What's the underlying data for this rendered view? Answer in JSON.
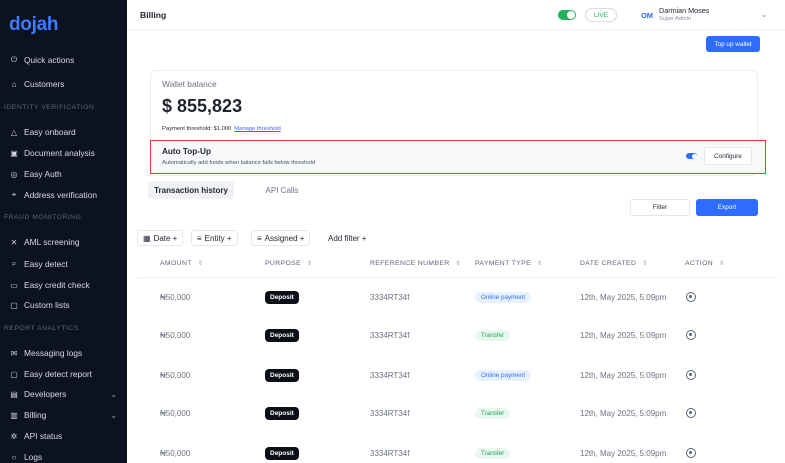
{
  "sidebar": {
    "logo": "dojah",
    "items": [
      {
        "label": "Quick actions",
        "icon": "⏻"
      },
      {
        "label": "Customers",
        "icon": "⌂"
      },
      {
        "label": "Easy onboard",
        "icon": "△"
      },
      {
        "label": "Document analysis",
        "icon": "▣"
      },
      {
        "label": "Easy Auth",
        "icon": "◎"
      },
      {
        "label": "Address verification",
        "icon": "⌖"
      },
      {
        "label": "AML screening",
        "icon": "✕"
      },
      {
        "label": "Easy detect",
        "icon": "⌕"
      },
      {
        "label": "Easy credit check",
        "icon": "▭"
      },
      {
        "label": "Custom lists",
        "icon": "▢"
      },
      {
        "label": "Messaging logs",
        "icon": "✉"
      },
      {
        "label": "Easy detect report",
        "icon": "▢"
      },
      {
        "label": "Developers",
        "icon": "▤"
      },
      {
        "label": "Billing",
        "icon": "▥"
      },
      {
        "label": "API status",
        "icon": "✲"
      },
      {
        "label": "Logs",
        "icon": "○"
      }
    ],
    "sections": {
      "identity": "IDENTITY VERIFICATION",
      "fraud": "FRAUD MONITORING",
      "report": "REPORT ANALYTICS"
    }
  },
  "header": {
    "title": "Billing",
    "mode": "LIVE",
    "avatar_initials": "OM",
    "user_name": "Darmian Moses",
    "user_role": "Super Admin",
    "top_up_label": "Top up wallet"
  },
  "wallet": {
    "label": "Wallet balance",
    "amount": "$ 855,823",
    "threshold_text": "Payment threshold: $1,000",
    "manage_link": "Manage threshold"
  },
  "auto_topup": {
    "title": "Auto Top-Up",
    "description": "Automatically add funds when balance falls below threshold",
    "configure_label": "Configure"
  },
  "tabs": [
    {
      "label": "Transaction history"
    },
    {
      "label": "API Calls"
    }
  ],
  "actions": {
    "filter_label": "Filter",
    "export_label": "Export"
  },
  "filters": [
    {
      "label": "Date +"
    },
    {
      "label": "Entity +"
    },
    {
      "label": "Assigned +"
    },
    {
      "label": "Add filter +"
    }
  ],
  "table": {
    "columns": [
      "AMOUNT",
      "PURPOSE",
      "REFERENCE NUMBER",
      "PAYMENT TYPE",
      "DATE CREATED",
      "ACTION"
    ],
    "rows": [
      {
        "amount": "₦50,000",
        "purpose": "Deposit",
        "reference": "3334RT34f",
        "payment_type": "Online payment",
        "date": "12th, May 2025, 5:09pm"
      },
      {
        "amount": "₦50,000",
        "purpose": "Deposit",
        "reference": "3334RT34f",
        "payment_type": "Transfer",
        "date": "12th, May 2025, 5:09pm"
      },
      {
        "amount": "₦50,000",
        "purpose": "Deposit",
        "reference": "3334RT34f",
        "payment_type": "Online payment",
        "date": "12th, May 2025, 5:09pm"
      },
      {
        "amount": "₦50,000",
        "purpose": "Deposit",
        "reference": "3334RT34f",
        "payment_type": "Transfer",
        "date": "12th, May 2025, 5:09pm"
      },
      {
        "amount": "₦50,000",
        "purpose": "Deposit",
        "reference": "3334RT34f",
        "payment_type": "Transfer",
        "date": "12th, May 2025, 5:09pm"
      }
    ]
  },
  "colors": {
    "sidebar_bg": "#0c1220",
    "accent": "#2e6bff",
    "live_green": "#21b35a",
    "highlight_red": "#ef3b2d"
  }
}
